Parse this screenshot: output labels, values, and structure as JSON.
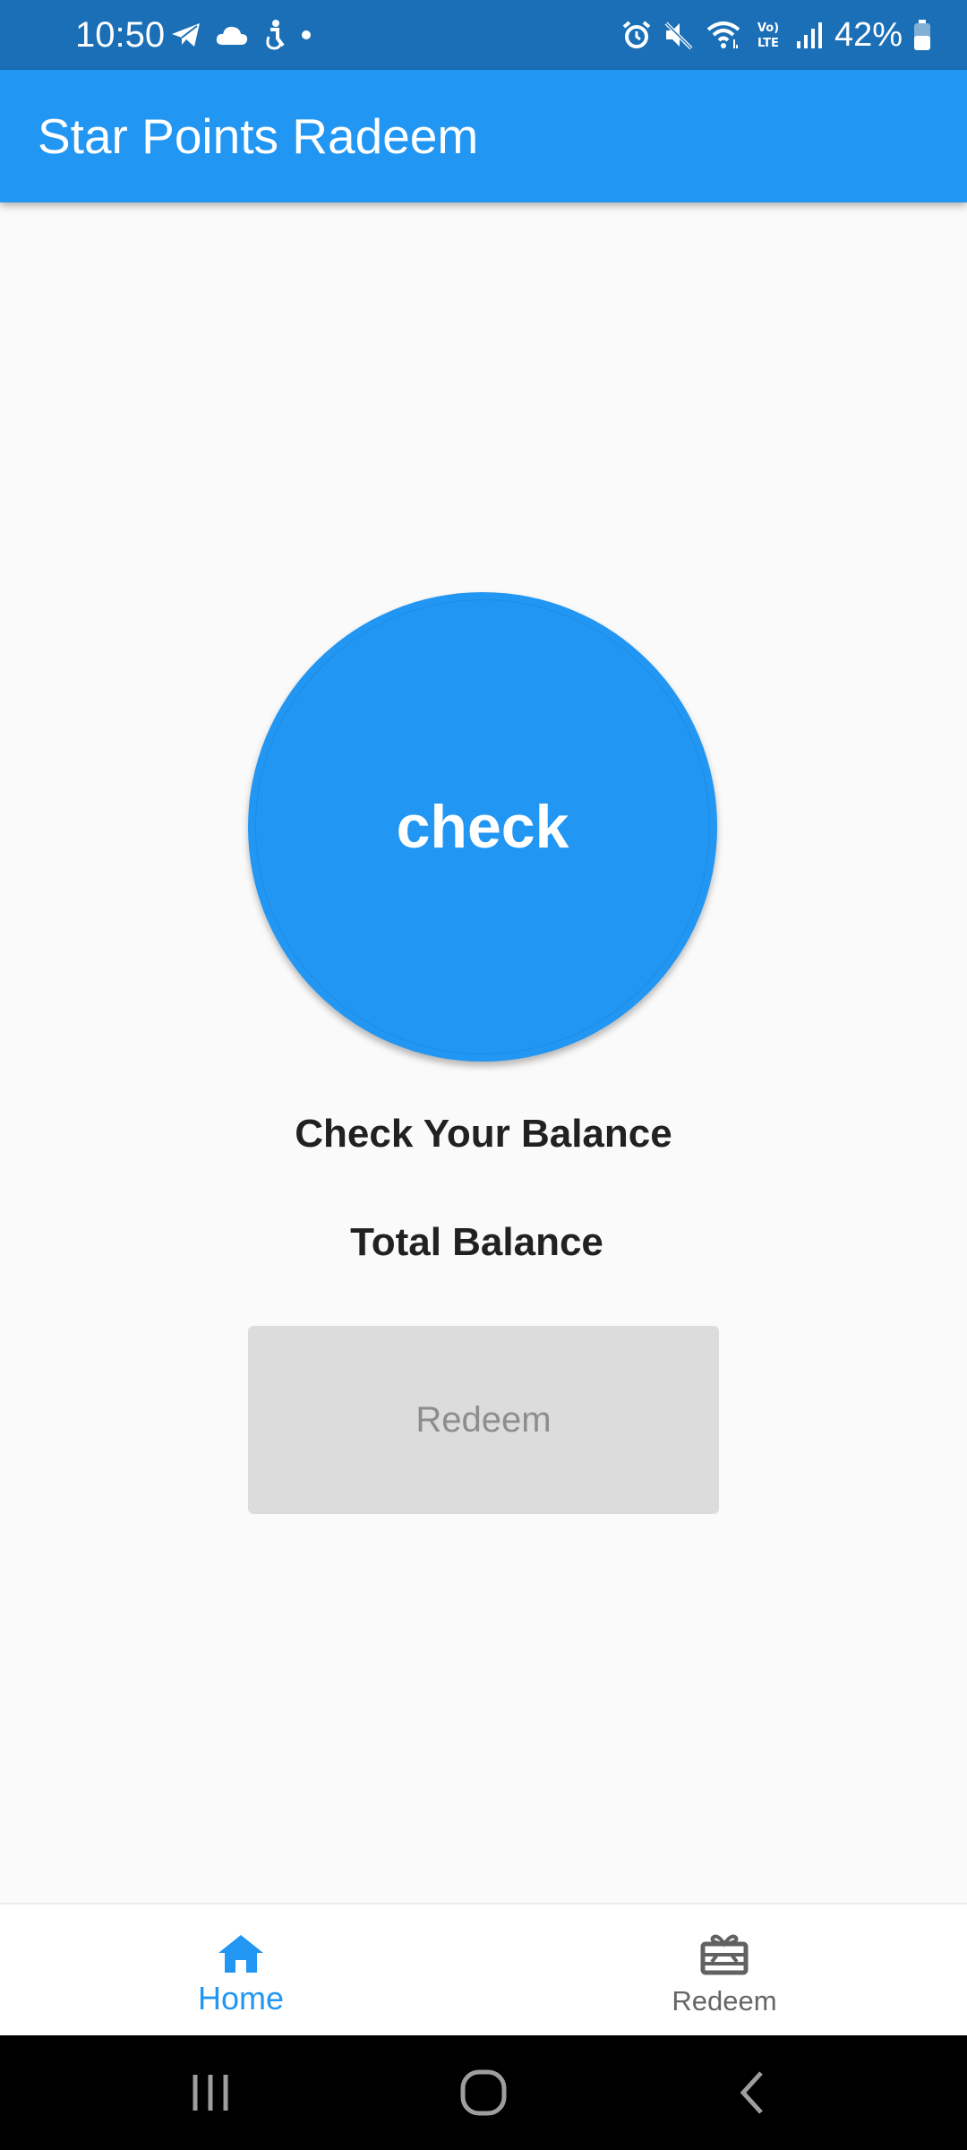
{
  "status_bar": {
    "time": "10:50",
    "battery": "42%",
    "left_icons": [
      "telegram-icon",
      "cloud-icon",
      "accessibility-icon",
      "dot-icon"
    ],
    "right_icons": [
      "alarm-icon",
      "mute-icon",
      "wifi-icon",
      "volte-icon",
      "signal-icon",
      "battery-icon"
    ]
  },
  "app_bar": {
    "title": "Star Points Radeem"
  },
  "main": {
    "check_button_label": "check",
    "heading": "Check Your Balance",
    "total_balance_label": "Total Balance",
    "redeem_button_label": "Redeem"
  },
  "bottom_nav": {
    "items": [
      {
        "label": "Home",
        "icon": "home-icon",
        "active": true
      },
      {
        "label": "Redeem",
        "icon": "gift-card-icon",
        "active": false
      }
    ]
  },
  "system_nav": {
    "buttons": [
      "recents-icon",
      "home-button-icon",
      "back-icon"
    ]
  },
  "colors": {
    "primary": "#2196f3",
    "status_bar": "#1a6fb7",
    "background": "#fafafa",
    "disabled_button": "#dcdcdc",
    "disabled_text": "#8d8d8d"
  }
}
